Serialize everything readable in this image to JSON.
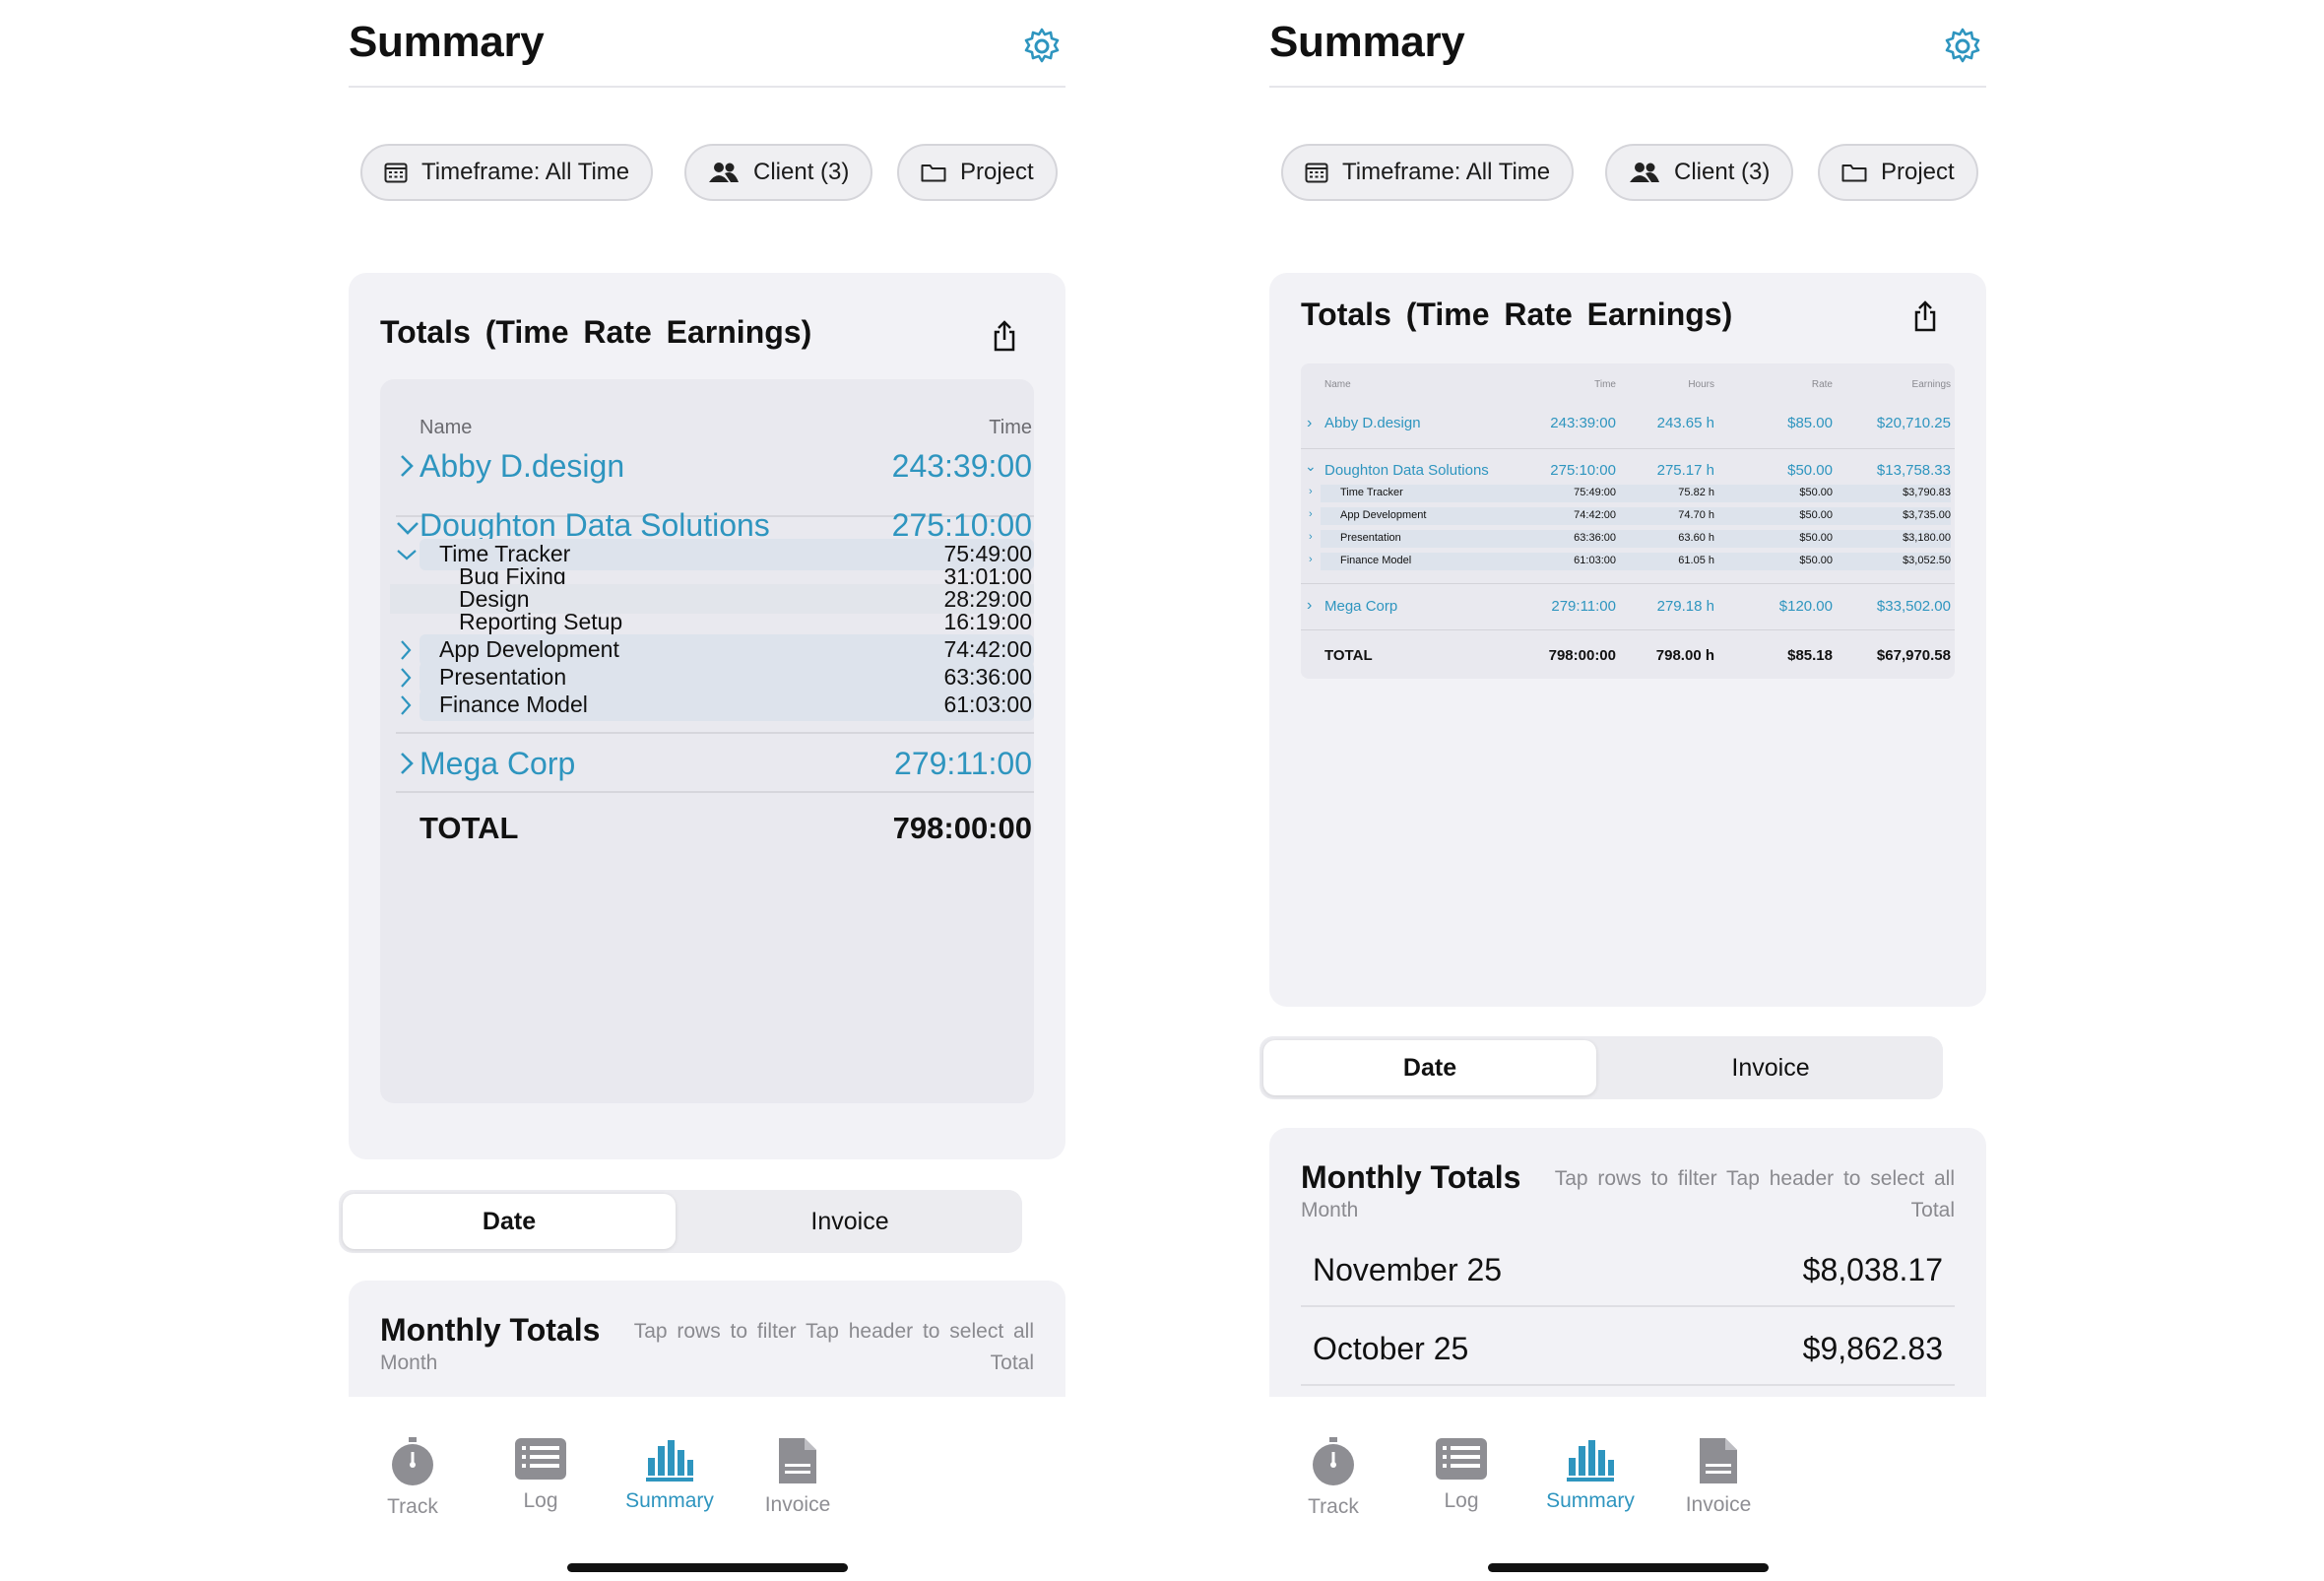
{
  "colors": {
    "accent": "#2e95bf",
    "card_bg": "#f2f2f6",
    "table_bg": "#e9e9ef"
  },
  "header": {
    "title": "Summary",
    "settings_icon": "gear-icon"
  },
  "filters": {
    "timeframe": "Timeframe: All Time",
    "client": "Client (3)",
    "project": "Project"
  },
  "totals_card": {
    "title": "Totals (Time  Rate  Earnings)",
    "share_icon": "share-icon"
  },
  "table_large": {
    "col_name": "Name",
    "col_time": "Time",
    "clients": [
      {
        "name": "Abby D.design",
        "time": "243:39:00"
      },
      {
        "name": "Doughton Data Solutions",
        "time": "275:10:00",
        "projects": [
          {
            "name": "Time Tracker",
            "time": "75:49:00",
            "tasks": [
              {
                "name": "Bug Fixing",
                "time": "31:01:00"
              },
              {
                "name": "Design",
                "time": "28:29:00"
              },
              {
                "name": "Reporting Setup",
                "time": "16:19:00"
              }
            ]
          },
          {
            "name": "App Development",
            "time": "74:42:00"
          },
          {
            "name": "Presentation",
            "time": "63:36:00"
          },
          {
            "name": "Finance Model",
            "time": "61:03:00"
          }
        ]
      },
      {
        "name": "Mega Corp",
        "time": "279:11:00"
      }
    ],
    "total_label": "TOTAL",
    "total_time": "798:00:00"
  },
  "table_small": {
    "headers": {
      "name": "Name",
      "time": "Time",
      "hours": "Hours",
      "rate": "Rate",
      "earnings": "Earnings"
    },
    "rows": [
      {
        "name": "Abby D.design",
        "time": "243:39:00",
        "hours": "243.65 h",
        "rate": "$85.00",
        "earnings": "$20,710.25"
      },
      {
        "name": "Doughton Data Solutions",
        "time": "275:10:00",
        "hours": "275.17 h",
        "rate": "$50.00",
        "earnings": "$13,758.33"
      },
      {
        "name": "Mega Corp",
        "time": "279:11:00",
        "hours": "279.18 h",
        "rate": "$120.00",
        "earnings": "$33,502.00"
      }
    ],
    "subrows": [
      {
        "name": "Time Tracker",
        "time": "75:49:00",
        "hours": "75.82 h",
        "rate": "$50.00",
        "earnings": "$3,790.83"
      },
      {
        "name": "App Development",
        "time": "74:42:00",
        "hours": "74.70 h",
        "rate": "$50.00",
        "earnings": "$3,735.00"
      },
      {
        "name": "Presentation",
        "time": "63:36:00",
        "hours": "63.60 h",
        "rate": "$50.00",
        "earnings": "$3,180.00"
      },
      {
        "name": "Finance Model",
        "time": "61:03:00",
        "hours": "61.05 h",
        "rate": "$50.00",
        "earnings": "$3,052.50"
      }
    ],
    "total": {
      "label": "TOTAL",
      "time": "798:00:00",
      "hours": "798.00 h",
      "rate": "$85.18",
      "earnings": "$67,970.58"
    }
  },
  "segment": {
    "date": "Date",
    "invoice": "Invoice"
  },
  "monthly": {
    "title": "Monthly Totals",
    "hint": "Tap rows to filter  Tap header to select all",
    "col_month": "Month",
    "col_total": "Total",
    "rows": [
      {
        "month": "November 25",
        "total": "$8,038.17"
      },
      {
        "month": "October 25",
        "total": "$9,862.83"
      }
    ]
  },
  "tabs": [
    {
      "label": "Track",
      "icon": "stopwatch-icon"
    },
    {
      "label": "Log",
      "icon": "list-icon"
    },
    {
      "label": "Summary",
      "icon": "bar-chart-icon"
    },
    {
      "label": "Invoice",
      "icon": "document-icon"
    }
  ]
}
